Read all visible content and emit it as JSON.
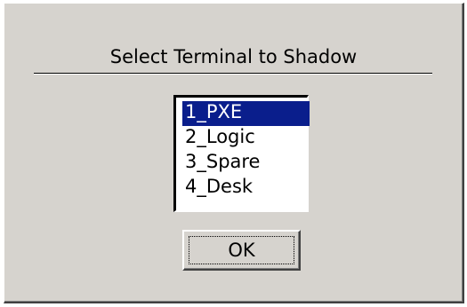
{
  "dialog": {
    "title": "Select Terminal to Shadow",
    "terminals": [
      {
        "label": "1_PXE",
        "selected": true
      },
      {
        "label": "2_Logic",
        "selected": false
      },
      {
        "label": "3_Spare",
        "selected": false
      },
      {
        "label": "4_Desk",
        "selected": false
      }
    ],
    "ok_label": "OK"
  },
  "colors": {
    "background": "#d6d3ce",
    "selection": "#0a1e8c"
  }
}
